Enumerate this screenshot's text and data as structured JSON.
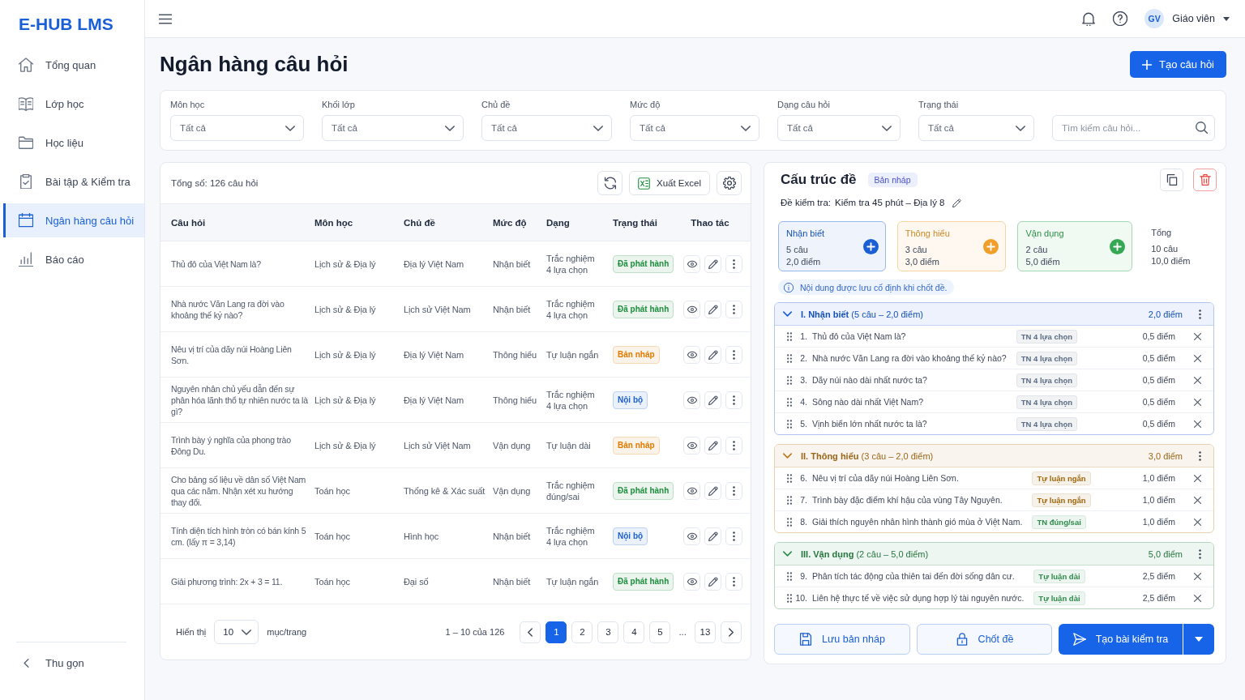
{
  "sidebar": {
    "logo": "E-HUB LMS",
    "items": [
      {
        "label": "Tổng quan",
        "selected": false
      },
      {
        "label": "Lớp học",
        "selected": false
      },
      {
        "label": "Học liệu",
        "selected": false
      },
      {
        "label": "Bài tập & Kiểm tra",
        "selected": false
      },
      {
        "label": "Ngân hàng câu hỏi",
        "selected": true
      },
      {
        "label": "Báo cáo",
        "selected": false
      }
    ],
    "collapse": "Thu gọn"
  },
  "topbar": {
    "user": {
      "initials": "GV",
      "name": "Giáo viên"
    }
  },
  "page": {
    "title": "Ngân hàng câu hỏi",
    "create_button": "Tạo câu hỏi"
  },
  "filters": {
    "selects": [
      {
        "label": "Môn học",
        "value": "Tất cả"
      },
      {
        "label": "Khối lớp",
        "value": "Tất cả"
      },
      {
        "label": "Chủ đề",
        "value": "Tất cả"
      },
      {
        "label": "Mức độ",
        "value": "Tất cả"
      },
      {
        "label": "Dạng câu hỏi",
        "value": "Tất cả"
      },
      {
        "label": "Trạng thái",
        "value": "Tất cả"
      }
    ],
    "search": {
      "placeholder": "Tìm kiếm câu hỏi..."
    }
  },
  "question_table": {
    "total": "Tổng số: 126 câu hỏi",
    "export_button": "Xuất Excel",
    "columns": [
      "Câu hỏi",
      "Môn học",
      "Chủ đề",
      "Mức độ",
      "Dạng",
      "Trạng thái",
      "Thao tác"
    ],
    "rows": [
      {
        "question": "Thủ đô của Việt Nam là?",
        "subject": "Lịch sử & Địa lý",
        "topic": "Địa lý Việt Nam",
        "difficulty": "Nhận biết",
        "type": "Trắc nghiệm\n4 lựa chọn",
        "status": {
          "label": "Đã phát hành",
          "color": "#1e8e3e"
        }
      },
      {
        "question": "Nhà nước Văn Lang ra đời vào khoảng thế kỷ nào?",
        "subject": "Lịch sử & Địa lý",
        "topic": "Lịch sử Việt Nam",
        "difficulty": "Nhận biết",
        "type": "Trắc nghiệm\n4 lựa chọn",
        "status": {
          "label": "Đã phát hành",
          "color": "#1e8e3e"
        }
      },
      {
        "question": "Nêu vị trí của dãy núi Hoàng Liên Sơn.",
        "subject": "Lịch sử & Địa lý",
        "topic": "Địa lý Việt Nam",
        "difficulty": "Thông hiểu",
        "type": "Tự luận ngắn",
        "status": {
          "label": "Bản nháp",
          "color": "#e07b00"
        }
      },
      {
        "question": "Nguyên nhân chủ yếu dẫn đến sự phân hóa lãnh thổ tự nhiên nước ta là gì?",
        "subject": "Lịch sử & Địa lý",
        "topic": "Địa lý Việt Nam",
        "difficulty": "Thông hiểu",
        "type": "Trắc nghiệm\n4 lựa chọn",
        "status": {
          "label": "Nội bộ",
          "color": "#1a5fd6"
        }
      },
      {
        "question": "Trình bày ý nghĩa của phong trào Đông Du.",
        "subject": "Lịch sử & Địa lý",
        "topic": "Lịch sử Việt Nam",
        "difficulty": "Vận dụng",
        "type": "Tự luận dài",
        "status": {
          "label": "Bản nháp",
          "color": "#e07b00"
        }
      },
      {
        "question": "Cho bảng số liệu về dân số Việt Nam qua các năm. Nhận xét xu hướng thay đổi.",
        "subject": "Toán học",
        "topic": "Thống kê & Xác suất",
        "difficulty": "Vận dụng",
        "type": "Trắc nghiệm\nđúng/sai",
        "status": {
          "label": "Đã phát hành",
          "color": "#1e8e3e"
        }
      },
      {
        "question": "Tính diện tích hình tròn có bán kính 5 cm. (lấy π = 3,14)",
        "subject": "Toán học",
        "topic": "Hình học",
        "difficulty": "Nhận biết",
        "type": "Trắc nghiệm\n4 lựa chọn",
        "status": {
          "label": "Nội bộ",
          "color": "#1a5fd6"
        }
      },
      {
        "question": "Giải phương trình: 2x + 3 = 11.",
        "subject": "Toán học",
        "topic": "Đại số",
        "difficulty": "Nhận biết",
        "type": "Tự luận ngắn",
        "status": {
          "label": "Đã phát hành",
          "color": "#1e8e3e"
        }
      }
    ],
    "pagination": {
      "page_size_label": "Hiển thị",
      "page_size": "10",
      "page_size_unit": "mục/trang",
      "range": "1 – 10 của 126",
      "pages": [
        {
          "label": "1",
          "selected": true
        },
        {
          "label": "2",
          "selected": false
        },
        {
          "label": "3",
          "selected": false
        },
        {
          "label": "4",
          "selected": false
        },
        {
          "label": "5",
          "selected": false
        }
      ],
      "ellipsis": "...",
      "last_page": {
        "label": "13",
        "selected": false
      }
    }
  },
  "exam_structure": {
    "title": "Cấu trúc đề",
    "badge": "Bản nháp",
    "exam_label": "Đề kiểm tra:",
    "exam_name": "Kiểm tra 45 phút – Địa lý 8",
    "levels": [
      {
        "title": "Nhận biết",
        "count": "5 câu",
        "points": "2,0 điểm",
        "color": "#1a5fd6"
      },
      {
        "title": "Thông hiểu",
        "count": "3 câu",
        "points": "3,0 điểm",
        "color": "#f0a02a"
      },
      {
        "title": "Vận dụng",
        "count": "2 câu",
        "points": "5,0 điểm",
        "color": "#34a853"
      }
    ],
    "total": {
      "title": "Tổng",
      "count": "10 câu",
      "points": "10,0 điểm"
    },
    "note": "Nội dung được lưu cố định khi chốt đề.",
    "sections": [
      {
        "title": "**I. Nhận biết** (5 câu – 2,0 điểm)",
        "points": "2,0 điểm",
        "color": "#1a5fd6",
        "expanded": true,
        "questions": [
          {
            "number": "1.",
            "text": "Thủ đô của Việt Nam là?",
            "type": {
              "label": "TN 4 lựa chọn",
              "color": "#5b6b82"
            },
            "points": "0,5 điểm"
          },
          {
            "number": "2.",
            "text": "Nhà nước Văn Lang ra đời vào khoảng thế kỷ nào?",
            "type": {
              "label": "TN 4 lựa chọn",
              "color": "#5b6b82"
            },
            "points": "0,5 điểm"
          },
          {
            "number": "3.",
            "text": "Dãy núi nào dài nhất nước ta?",
            "type": {
              "label": "TN 4 lựa chọn",
              "color": "#5b6b82"
            },
            "points": "0,5 điểm"
          },
          {
            "number": "4.",
            "text": "Sông nào dài nhất Việt Nam?",
            "type": {
              "label": "TN 4 lựa chọn",
              "color": "#5b6b82"
            },
            "points": "0,5 điểm"
          },
          {
            "number": "5.",
            "text": "Vịnh biển lớn nhất nước ta là?",
            "type": {
              "label": "TN 4 lựa chọn",
              "color": "#5b6b82"
            },
            "points": "0,5 điểm"
          }
        ]
      },
      {
        "title": "**II. Thông hiểu** (3 câu – 2,0 điểm)",
        "points": "3,0 điểm",
        "color": "#b7791f",
        "expanded": true,
        "questions": [
          {
            "number": "6.",
            "text": "Nêu vị trí của dãy núi Hoàng Liên Sơn.",
            "type": {
              "label": "Tự luận ngắn",
              "color": "#a0660c"
            },
            "points": "1,0 điểm"
          },
          {
            "number": "7.",
            "text": "Trình bày đặc điểm khí hậu của vùng Tây Nguyên.",
            "type": {
              "label": "Tự luận ngắn",
              "color": "#a0660c"
            },
            "points": "1,0 điểm"
          },
          {
            "number": "8.",
            "text": "Giải thích nguyên nhân hình thành gió mùa ở Việt Nam.",
            "type": {
              "label": "TN đúng/sai",
              "color": "#2e8b4a"
            },
            "points": "1,0 điểm"
          }
        ]
      },
      {
        "title": "**III. Vận dụng** (2 câu – 5,0 điểm)",
        "points": "5,0 điểm",
        "color": "#2e8b4a",
        "expanded": true,
        "questions": [
          {
            "number": "9.",
            "text": "Phân tích tác động của thiên tai đến đời sống dân cư.",
            "type": {
              "label": "Tự luận dài",
              "color": "#2e8b4a"
            },
            "points": "2,5 điểm"
          },
          {
            "number": "10.",
            "text": "Liên hệ thực tế về việc sử dụng hợp lý tài nguyên nước.",
            "type": {
              "label": "Tự luận dài",
              "color": "#2e8b4a"
            },
            "points": "2,5 điểm"
          }
        ]
      }
    ],
    "actions": {
      "save": "Lưu bản nháp",
      "lock": "Chốt đề",
      "create": "Tạo bài kiểm tra"
    }
  }
}
